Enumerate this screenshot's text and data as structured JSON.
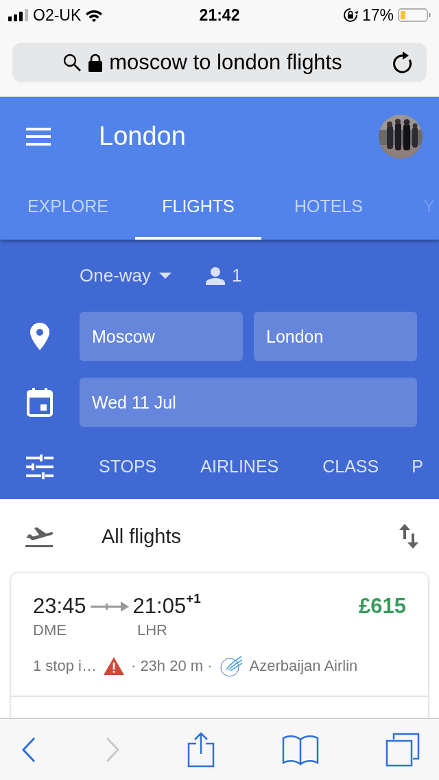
{
  "status_bar": {
    "carrier": "O2-UK",
    "time": "21:42",
    "battery": "17%"
  },
  "url_bar": {
    "query": "moscow to london flights"
  },
  "app_bar": {
    "title": "London"
  },
  "tabs": [
    {
      "label": "EXPLORE",
      "selected": false
    },
    {
      "label": "FLIGHTS",
      "selected": true
    },
    {
      "label": "HOTELS",
      "selected": false
    },
    {
      "label": "Y",
      "selected": false
    }
  ],
  "search": {
    "trip_type": "One-way",
    "passengers": "1",
    "origin": "Moscow",
    "destination": "London",
    "date": "Wed 11 Jul",
    "filters": [
      "STOPS",
      "AIRLINES",
      "CLASS",
      "P"
    ]
  },
  "results": {
    "heading": "All flights",
    "flights": [
      {
        "depart": "23:45",
        "arrive": "21:05",
        "day_offset": "+1",
        "from": "DME",
        "to": "LHR",
        "price": "£615",
        "stops": "1 stop i…",
        "warning": true,
        "duration": "· 23h 20 m ·",
        "airline": "Azerbaijan Airlin"
      }
    ]
  },
  "toolbar": {
    "back_disabled": false,
    "forward_disabled": true
  }
}
